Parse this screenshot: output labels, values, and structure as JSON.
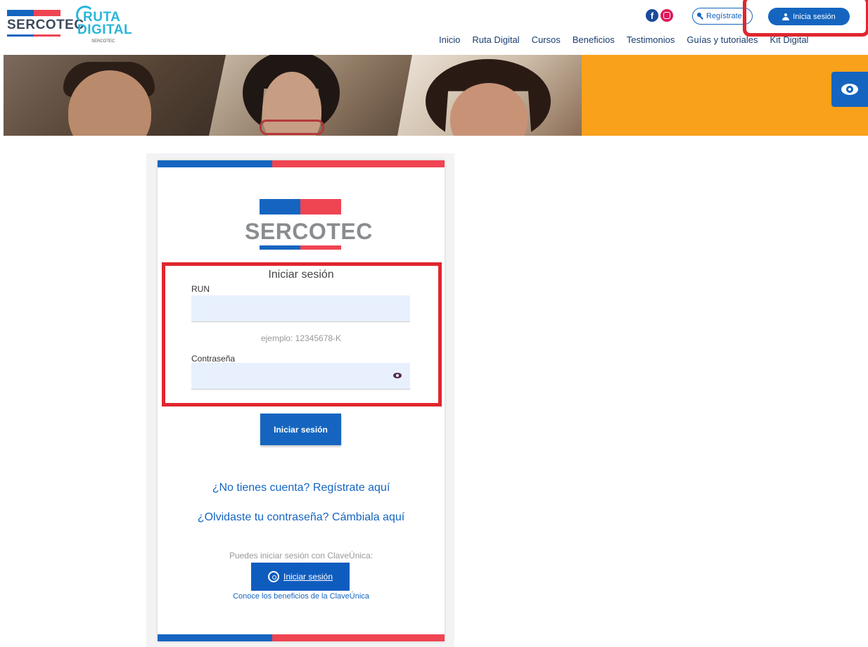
{
  "header": {
    "logo_text": "SERCOTEC",
    "ruta_line1": "RUTA",
    "ruta_line2": "DIGITAL",
    "ruta_sub": "SERCOTEC",
    "facebook_glyph": "f",
    "registrate_label": "Regístrate",
    "inicia_label": "Inicia sesión",
    "nav": [
      "Inicio",
      "Ruta Digital",
      "Cursos",
      "Beneficios",
      "Testimonios",
      "Guías y tutoriales",
      "Kit Digital"
    ]
  },
  "login": {
    "logo_text": "SERCOTEC",
    "title": "Iniciar sesión",
    "run_label": "RUN",
    "run_value": "",
    "run_hint": "ejemplo: 12345678-K",
    "password_label": "Contraseña",
    "password_value": "",
    "submit_label": "Iniciar sesión",
    "register_link": "¿No tienes cuenta? Regístrate aquí",
    "forgot_link": "¿Olvidaste tu contraseña? Cámbiala aquí",
    "claveunica_text": "Puedes iniciar sesión con ClaveÚnica:",
    "claveunica_button": "Iniciar sesión",
    "claveunica_link": "Conoce los beneficios de la ClaveÚnica"
  },
  "colors": {
    "primary": "#1565c0",
    "brand_red": "#ef4452",
    "banner_orange": "#f9a11b",
    "highlight": "#e0262e"
  },
  "icons": [
    "facebook-icon",
    "instagram-icon",
    "key-icon",
    "user-icon",
    "eye-icon",
    "password-eye-icon",
    "claveunica-icon"
  ]
}
